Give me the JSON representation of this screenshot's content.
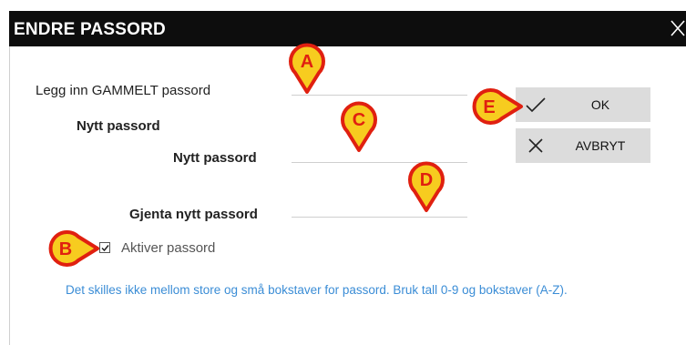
{
  "window": {
    "title": "ENDRE PASSORD",
    "close_icon": "close-icon"
  },
  "form": {
    "old_password_label": "Legg inn GAMMELT passord",
    "old_password_value": "",
    "new_section_heading": "Nytt passord",
    "new_password_label": "Nytt passord",
    "new_password_value": "",
    "repeat_password_label": "Gjenta nytt passord",
    "repeat_password_value": "",
    "enable_password_label": "Aktiver passord",
    "enable_password_checked": true,
    "info_text": "Det skilles ikke mellom store og små bokstaver for passord. Bruk tall 0-9 og bokstaver (A-Z)."
  },
  "buttons": {
    "ok_label": "OK",
    "ok_icon": "check-icon",
    "cancel_label": "AVBRYT",
    "cancel_icon": "close-icon"
  },
  "callouts": [
    "A",
    "B",
    "C",
    "D",
    "E"
  ],
  "colors": {
    "titlebar": "#0d0d0d",
    "button_bg": "#dcdcdc",
    "info_text": "#3b8dd6",
    "callout_fill": "#f7cc1f",
    "callout_stroke": "#e02010",
    "callout_text": "#e02010"
  }
}
